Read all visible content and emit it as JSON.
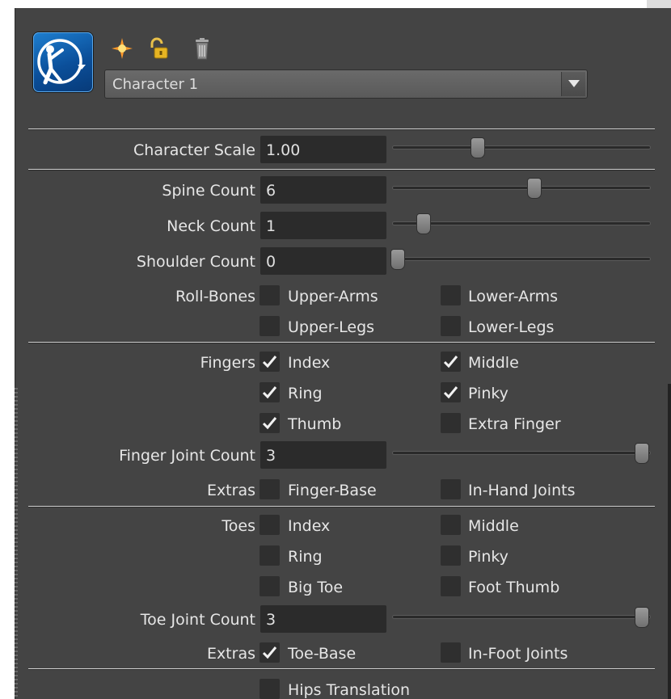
{
  "toolbar": {
    "icons": [
      "character-icon",
      "create-icon",
      "lock-icon",
      "delete-icon"
    ]
  },
  "character_select": {
    "value": "Character 1"
  },
  "character_scale": {
    "label": "Character Scale",
    "value": "1.00",
    "slider": 0.33
  },
  "spine_count": {
    "label": "Spine Count",
    "value": "6",
    "slider": 0.55
  },
  "neck_count": {
    "label": "Neck Count",
    "value": "1",
    "slider": 0.12
  },
  "shoulder_count": {
    "label": "Shoulder Count",
    "value": "0",
    "slider": 0.02
  },
  "roll_bones": {
    "label": "Roll-Bones",
    "upper_arms": {
      "label": "Upper-Arms",
      "checked": false
    },
    "lower_arms": {
      "label": "Lower-Arms",
      "checked": false
    },
    "upper_legs": {
      "label": "Upper-Legs",
      "checked": false
    },
    "lower_legs": {
      "label": "Lower-Legs",
      "checked": false
    }
  },
  "fingers": {
    "label": "Fingers",
    "index": {
      "label": "Index",
      "checked": true
    },
    "middle": {
      "label": "Middle",
      "checked": true
    },
    "ring": {
      "label": "Ring",
      "checked": true
    },
    "pinky": {
      "label": "Pinky",
      "checked": true
    },
    "thumb": {
      "label": "Thumb",
      "checked": true
    },
    "extra_finger": {
      "label": "Extra Finger",
      "checked": false
    }
  },
  "finger_joint_count": {
    "label": "Finger Joint Count",
    "value": "3",
    "slider": 0.97
  },
  "finger_extras": {
    "label": "Extras",
    "finger_base": {
      "label": "Finger-Base",
      "checked": false
    },
    "in_hand_joints": {
      "label": "In-Hand Joints",
      "checked": false
    }
  },
  "toes": {
    "label": "Toes",
    "index": {
      "label": "Index",
      "checked": false
    },
    "middle": {
      "label": "Middle",
      "checked": false
    },
    "ring": {
      "label": "Ring",
      "checked": false
    },
    "pinky": {
      "label": "Pinky",
      "checked": false
    },
    "big_toe": {
      "label": "Big Toe",
      "checked": false
    },
    "foot_thumb": {
      "label": "Foot Thumb",
      "checked": false
    }
  },
  "toe_joint_count": {
    "label": "Toe Joint Count",
    "value": "3",
    "slider": 0.97
  },
  "toe_extras": {
    "label": "Extras",
    "toe_base": {
      "label": "Toe-Base",
      "checked": true
    },
    "in_foot_joints": {
      "label": "In-Foot Joints",
      "checked": false
    }
  },
  "hips_translation": {
    "label": "Hips Translation",
    "checked": false
  }
}
